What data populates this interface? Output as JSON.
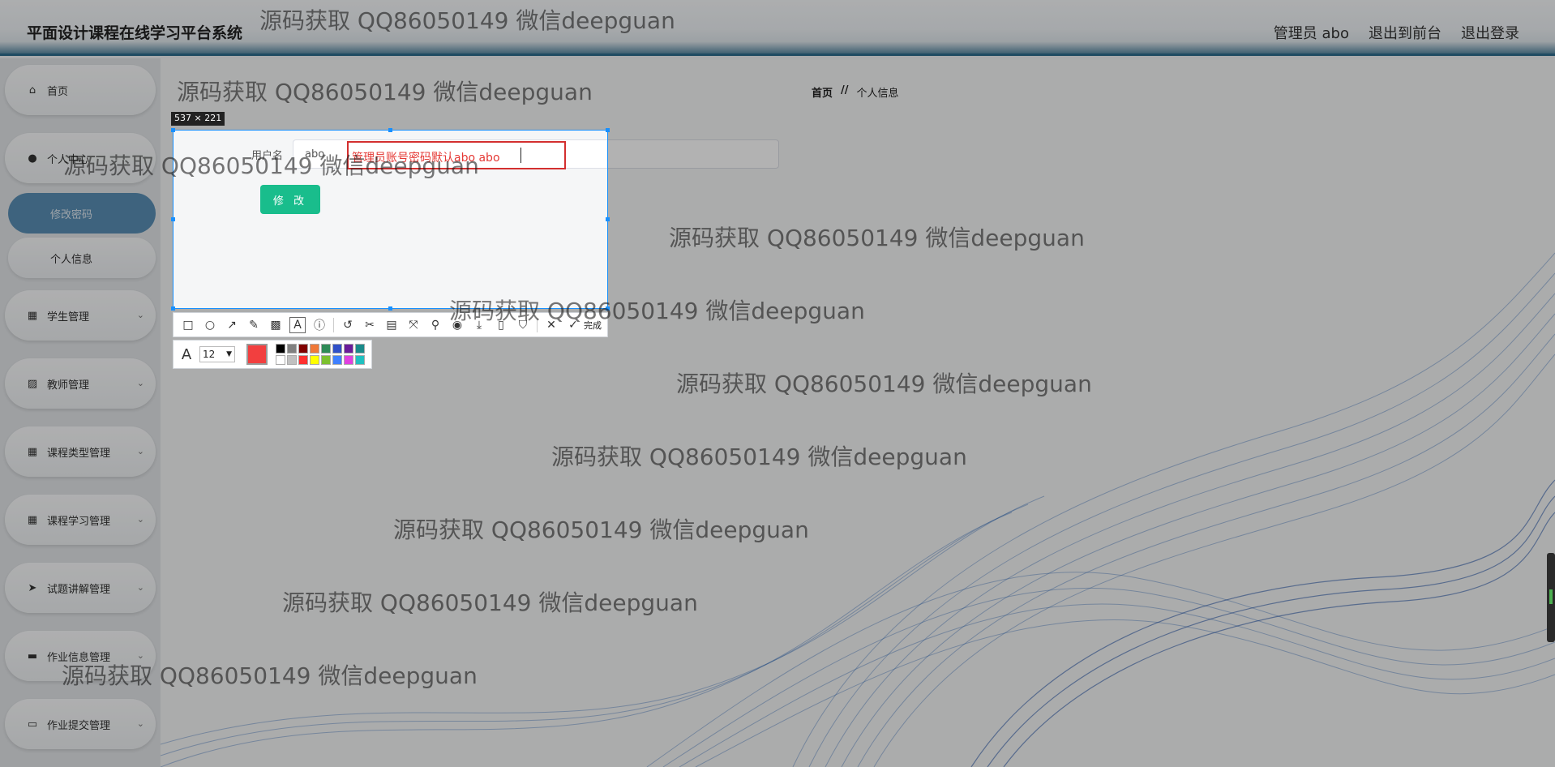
{
  "header": {
    "app_title": "平面设计课程在线学习平台系统",
    "user_label": "管理员 abo",
    "to_front": "退出到前台",
    "logout": "退出登录"
  },
  "sidebar": {
    "items": [
      {
        "label": "首页",
        "icon": "home-icon"
      },
      {
        "label": "个人中心",
        "icon": "user-icon"
      },
      {
        "label": "学生管理",
        "icon": "grid-icon"
      },
      {
        "label": "教师管理",
        "icon": "chart-icon"
      },
      {
        "label": "课程类型管理",
        "icon": "grid-icon"
      },
      {
        "label": "课程学习管理",
        "icon": "grid-icon"
      },
      {
        "label": "试题讲解管理",
        "icon": "send-icon"
      },
      {
        "label": "作业信息管理",
        "icon": "monitor-icon"
      },
      {
        "label": "作业提交管理",
        "icon": "chat-icon"
      }
    ],
    "sub_items": [
      {
        "label": "修改密码",
        "active": true
      },
      {
        "label": "个人信息",
        "active": false
      }
    ]
  },
  "breadcrumb": {
    "home": "首页",
    "separator": "//",
    "current": "个人信息"
  },
  "form": {
    "username_label": "用户名",
    "username_value": "abo",
    "submit_label": "修 改"
  },
  "capture_tool": {
    "size_label": "537 × 221",
    "annotation_text": "管理员账号密码默认abo abo",
    "done_label": "完成",
    "font_size": "12",
    "current_color": "#f23f3f",
    "palette": [
      "#000000",
      "#808080",
      "#800000",
      "#f07838",
      "#2e8b57",
      "#3050c8",
      "#6a1b9a",
      "#1a8a8a",
      "#ffffff",
      "#c0c0c0",
      "#ff3030",
      "#ffff00",
      "#7cc030",
      "#4080ff",
      "#e040e0",
      "#20c0c0"
    ]
  },
  "watermark": "源码获取 QQ86050149 微信deepguan"
}
